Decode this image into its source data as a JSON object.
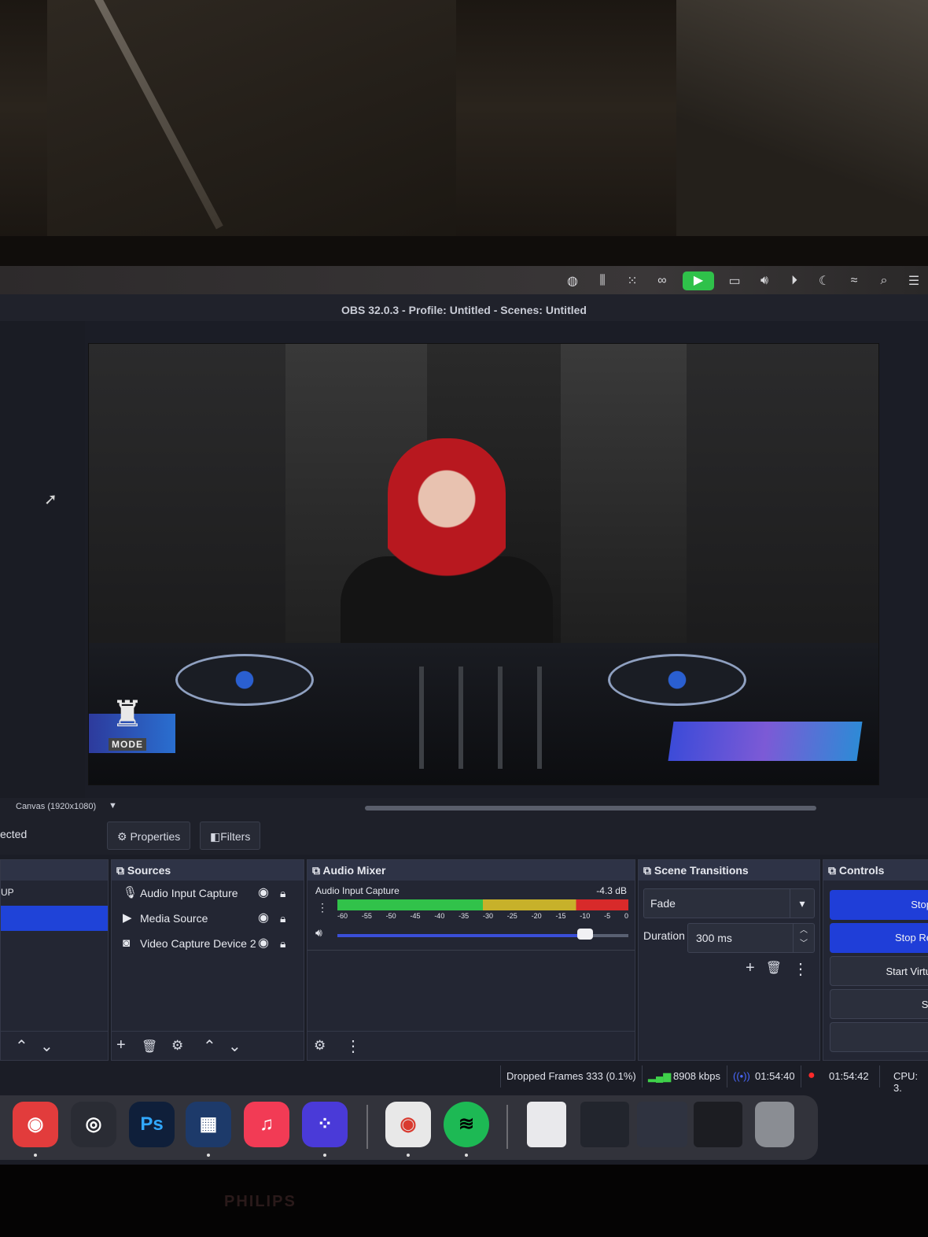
{
  "menubar": {
    "icons": [
      "screen-share-icon",
      "waveform-icon",
      "grid-icon",
      "creative-cloud-icon",
      "camera-icon",
      "battery-icon",
      "volume-icon",
      "play-icon",
      "moon-icon",
      "wifi-icon",
      "search-icon",
      "control-center-icon"
    ],
    "camera_active_color": "#2fc14a"
  },
  "window": {
    "title": "OBS 32.0.3 - Profile: Untitled - Scenes: Untitled"
  },
  "preview": {
    "logo_text": "MODE"
  },
  "canvas": {
    "label": "Canvas (1920x1080)"
  },
  "properties_bar": {
    "selection_text": "ected",
    "properties_label": "Properties",
    "filters_label": "Filters"
  },
  "scenes": {
    "item_label": "UP"
  },
  "sources": {
    "title": "Sources",
    "items": [
      {
        "icon": "microphone-icon",
        "name": "Audio Input Capture"
      },
      {
        "icon": "play-icon",
        "name": "Media Source"
      },
      {
        "icon": "camera-icon",
        "name": "Video Capture Device 2"
      }
    ]
  },
  "audio_mixer": {
    "title": "Audio Mixer",
    "channel_name": "Audio Input Capture",
    "level": "-4.3 dB",
    "ticks": [
      "-60",
      "-55",
      "-50",
      "-45",
      "-40",
      "-35",
      "-30",
      "-25",
      "-20",
      "-15",
      "-10",
      "-5",
      "0"
    ],
    "volume_fraction": 0.85
  },
  "scene_transitions": {
    "title": "Scene Transitions",
    "transition": "Fade",
    "duration_label": "Duration",
    "duration_value": "300 ms"
  },
  "controls": {
    "title": "Controls",
    "buttons": [
      "Stop",
      "Stop Re",
      "Start Virtu",
      "St"
    ]
  },
  "status": {
    "dropped_frames": "Dropped Frames 333 (0.1%)",
    "bitrate": "8908 kbps",
    "stream_time": "01:54:40",
    "record_time": "01:54:42",
    "cpu": "CPU: 3."
  },
  "dock_apps": [
    {
      "name": "Streamlabs",
      "label": "◉",
      "color": "#e23c3c"
    },
    {
      "name": "OBS",
      "label": "◎",
      "color": "#2a2c34"
    },
    {
      "name": "Photoshop",
      "label": "Ps",
      "color": "#0f1f3a"
    },
    {
      "name": "Grid App",
      "label": "▦",
      "color": "#1d3a6a"
    },
    {
      "name": "Music",
      "label": "♫",
      "color": "#f23b55"
    },
    {
      "name": "Launchpad",
      "label": "⁘",
      "color": "#4a3ad8"
    },
    {
      "name": "Chrome",
      "label": "◉",
      "color": "#e8e8e8"
    },
    {
      "name": "Spotify",
      "label": "≋",
      "color": "#1db954"
    }
  ],
  "monitor": {
    "brand": "PHILIPS"
  }
}
